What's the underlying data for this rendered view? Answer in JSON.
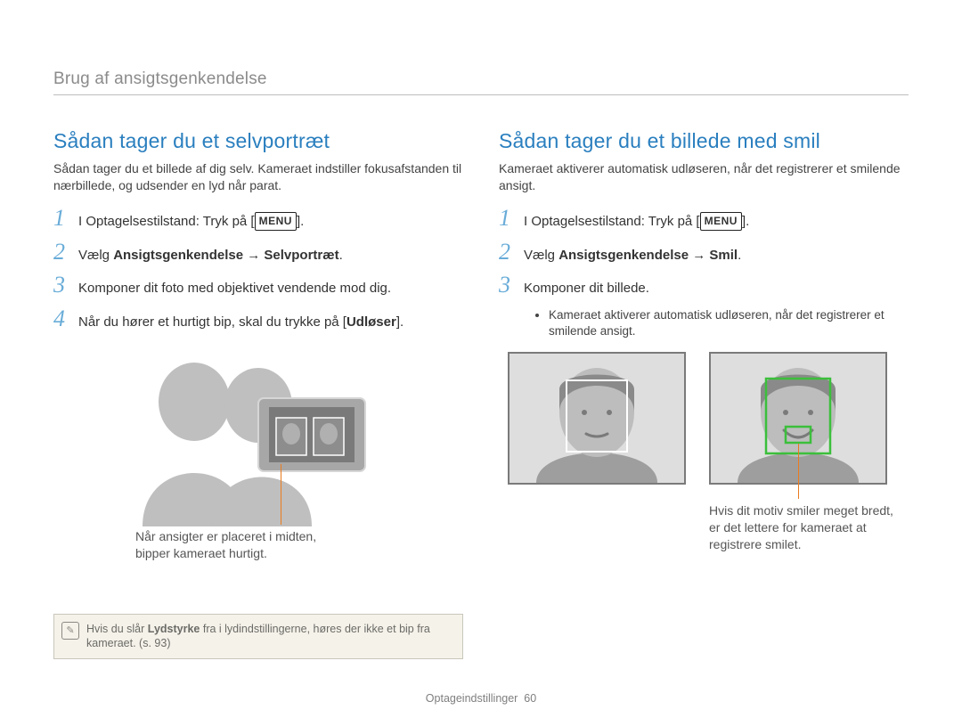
{
  "breadcrumb": "Brug af ansigtsgenkendelse",
  "left": {
    "heading": "Sådan tager du et selvportræt",
    "intro": "Sådan tager du et billede af dig selv. Kameraet indstiller fokusafstanden til nærbillede, og udsender en lyd når parat.",
    "steps": {
      "s1_a": "I Optagelsestilstand: Tryk på [",
      "s1_menu": "MENU",
      "s1_b": "].",
      "s2_a": "Vælg ",
      "s2_bold": "Ansigtsgenkendelse → Selvportræt",
      "s2_b": ".",
      "s3": "Komponer dit foto med objektivet vendende mod dig.",
      "s4_a": "Når du hører et hurtigt bip, skal du trykke på [",
      "s4_bold": "Udløser",
      "s4_b": "]."
    },
    "caption": "Når ansigter er placeret i midten,\nbipper kameraet hurtigt.",
    "note_a": "Hvis du slår ",
    "note_bold": "Lydstyrke",
    "note_b": " fra i lydindstillingerne, høres der ikke et bip fra kameraet. (s. 93)"
  },
  "right": {
    "heading": "Sådan tager du et billede med smil",
    "intro": "Kameraet aktiverer automatisk udløseren, når det registrerer et smilende ansigt.",
    "steps": {
      "s1_a": "I Optagelsestilstand: Tryk på [",
      "s1_menu": "MENU",
      "s1_b": "].",
      "s2_a": "Vælg ",
      "s2_bold": "Ansigtsgenkendelse → Smil",
      "s2_b": ".",
      "s3": "Komponer dit billede."
    },
    "bullet": "Kameraet aktiverer automatisk udløseren, når det registrerer et smilende ansigt.",
    "caption": "Hvis dit motiv smiler meget bredt,\ner det lettere for kameraet at\nregistrere smilet."
  },
  "footer_label": "Optageindstillinger",
  "footer_page": "60",
  "step_numbers": [
    "1",
    "2",
    "3",
    "4"
  ]
}
